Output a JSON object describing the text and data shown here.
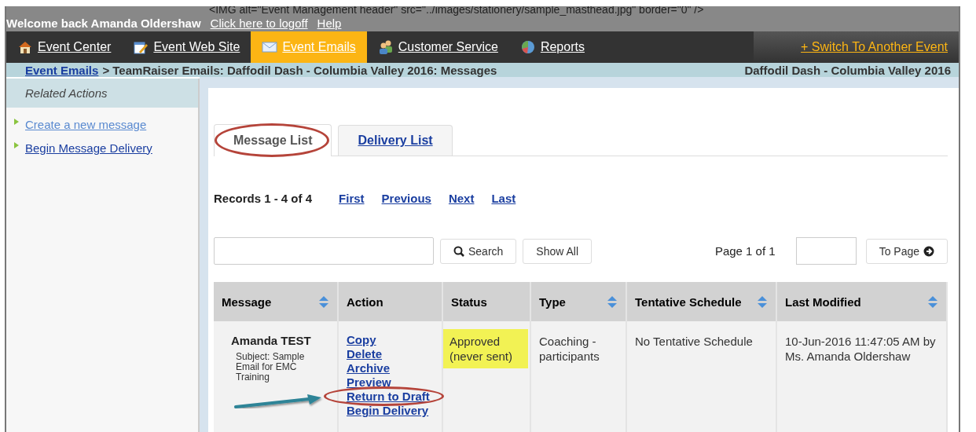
{
  "header": {
    "broken_image_text": "<IMG alt=\"Event Management header\" src=\"../images/stationery/sample_masthead.jpg\" border=\"0\" />",
    "welcome": "Welcome back Amanda Oldershaw",
    "links": [
      "Click here to logoff",
      "Help"
    ]
  },
  "nav": {
    "items": [
      {
        "label": "Event Center",
        "selected": false
      },
      {
        "label": "Event Web Site",
        "selected": false
      },
      {
        "label": "Event Emails",
        "selected": true
      },
      {
        "label": "Customer Service",
        "selected": false
      },
      {
        "label": "Reports",
        "selected": false
      }
    ],
    "switch_link": "+ Switch To Another Event"
  },
  "breadcrumb": {
    "link": "Event Emails",
    "trail": "> TeamRaiser Emails: Daffodil Dash - Columbia Valley 2016: Messages",
    "event": "Daffodil Dash - Columbia Valley 2016"
  },
  "sidebar": {
    "title": "Related Actions",
    "items": [
      {
        "label": "Create a new message",
        "visited": true
      },
      {
        "label": "Begin Message Delivery",
        "visited": false
      }
    ]
  },
  "tabs": [
    {
      "label": "Message List",
      "selected": true,
      "circled": true
    },
    {
      "label": "Delivery List",
      "selected": false,
      "circled": false
    }
  ],
  "pager": {
    "records": "Records 1 - 4 of 4",
    "links": [
      "First",
      "Previous",
      "Next",
      "Last"
    ]
  },
  "search": {
    "button": "Search",
    "show_all": "Show All",
    "page": "Page 1 of 1",
    "to_page": "To Page"
  },
  "table": {
    "columns": [
      {
        "label": "Message",
        "sortable": true
      },
      {
        "label": "Action",
        "sortable": false
      },
      {
        "label": "Status",
        "sortable": false
      },
      {
        "label": "Type",
        "sortable": true
      },
      {
        "label": "Tentative Schedule",
        "sortable": true
      },
      {
        "label": "Last Modified",
        "sortable": true
      }
    ],
    "rows": [
      {
        "message": "Amanda TEST",
        "subject": "Subject: Sample Email for EMC Training",
        "arrow": true,
        "actions": [
          {
            "label": "Copy",
            "circled": false
          },
          {
            "label": "Delete",
            "circled": false
          },
          {
            "label": "Archive",
            "circled": false
          },
          {
            "label": "Preview",
            "circled": false
          },
          {
            "label": "Return to Draft",
            "circled": true
          },
          {
            "label": "Begin Delivery",
            "circled": false
          }
        ],
        "status": "Approved (never sent)",
        "status_highlighted": true,
        "type": "Coaching - participants",
        "schedule": "No Tentative Schedule",
        "modified": "10-Jun-2016 11:47:05 AM by Ms. Amanda Oldershaw"
      }
    ]
  }
}
